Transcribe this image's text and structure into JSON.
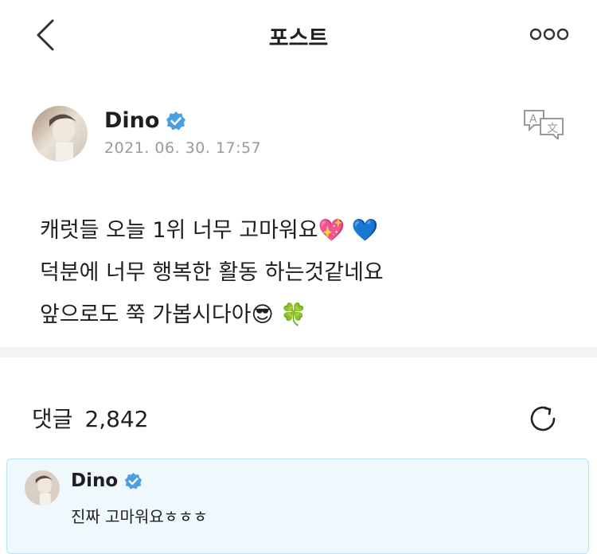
{
  "header": {
    "title": "포스트"
  },
  "author": {
    "name": "Dino",
    "date": "2021. 06. 30. 17:57"
  },
  "post": {
    "lines": [
      "캐럿들 오늘 1위 너무 고마워요💖 💙",
      "덕분에 너무 행복한 활동 하는것같네요",
      "앞으로도 쭉 가봅시다아😎 🍀"
    ]
  },
  "comments": {
    "label": "댓글",
    "count": "2,842"
  },
  "pinned_comment": {
    "name": "Dino",
    "text": "진짜 고마워요ㅎㅎㅎ"
  },
  "colors": {
    "verified": "#4a9fe3",
    "divider": "#f4f4f6",
    "pinned_bg": "#eef8fd"
  },
  "icons": [
    "chevron-left-icon",
    "more-icon",
    "verified-icon",
    "translate-icon",
    "refresh-icon"
  ]
}
